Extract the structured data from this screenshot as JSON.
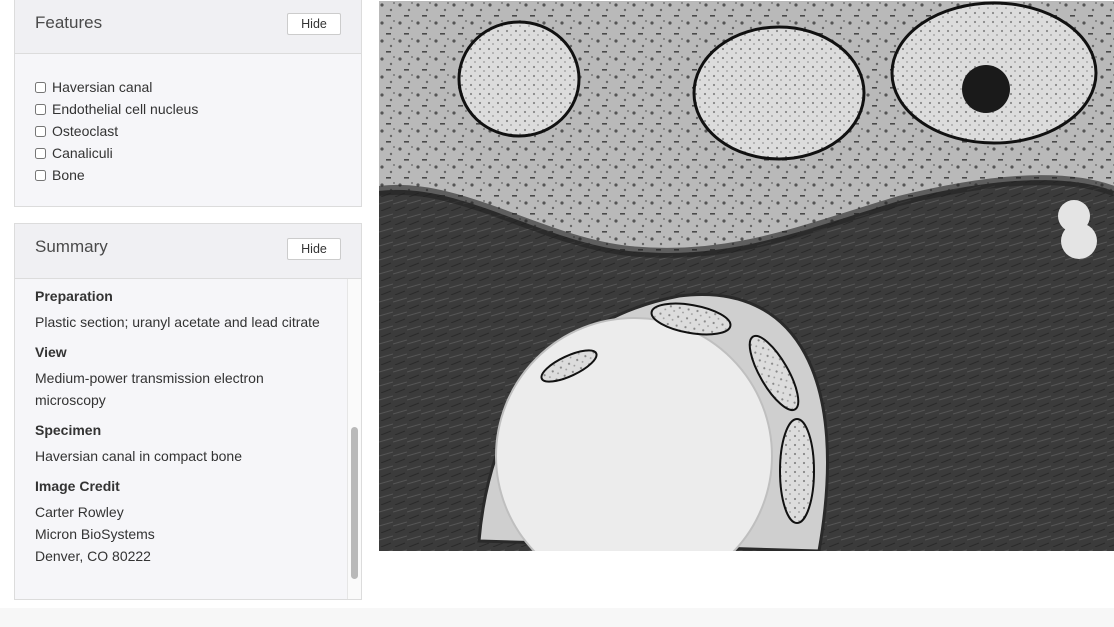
{
  "features": {
    "title": "Features",
    "hide_label": "Hide",
    "items": [
      {
        "label": "Haversian canal",
        "checked": false
      },
      {
        "label": "Endothelial cell nucleus",
        "checked": false
      },
      {
        "label": "Osteoclast",
        "checked": false
      },
      {
        "label": "Canaliculi",
        "checked": false
      },
      {
        "label": "Bone",
        "checked": false
      }
    ]
  },
  "summary": {
    "title": "Summary",
    "hide_label": "Hide",
    "sections": [
      {
        "label": "Preparation",
        "lines": [
          "Plastic section; uranyl acetate and lead citrate"
        ]
      },
      {
        "label": "View",
        "lines": [
          "Medium-power transmission electron",
          "microscopy"
        ]
      },
      {
        "label": "Specimen",
        "lines": [
          "Haversian canal in compact bone"
        ]
      },
      {
        "label": "Image Credit",
        "lines": [
          "Carter Rowley",
          "Micron BioSystems",
          "Denver, CO 80222"
        ]
      }
    ]
  },
  "image": {
    "colors": {
      "cytoplasm": "#b8b8b8",
      "bone_matrix": "#3a3a3a",
      "lumen": "#ececec",
      "nucleus": "#d6d6d6"
    }
  }
}
